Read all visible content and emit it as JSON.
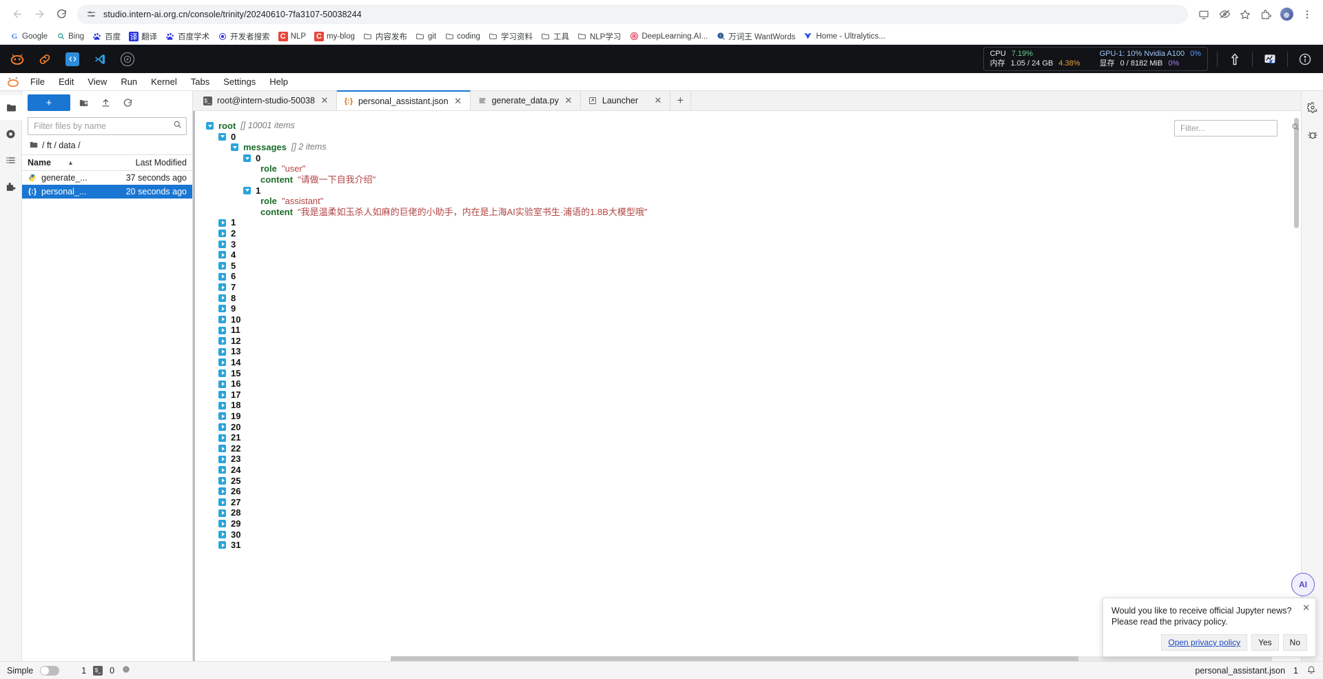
{
  "browser": {
    "nav": {
      "back": "←",
      "forward": "→",
      "reload": "⟳"
    },
    "url": "studio.intern-ai.org.cn/console/trinity/20240610-7fa3107-50038244",
    "right_icons": [
      "media-cast-icon",
      "eye-off-icon",
      "bookmark-star-icon",
      "extensions-icon",
      "profile-avatar",
      "chrome-menu-icon"
    ],
    "bookmarks": [
      {
        "label": "Google",
        "icon": "google-icon"
      },
      {
        "label": "Bing",
        "icon": "bing-search-icon"
      },
      {
        "label": "百度",
        "icon": "baidu-icon"
      },
      {
        "label": "翻译",
        "icon": "translate-icon"
      },
      {
        "label": "百度学术",
        "icon": "baidu-icon"
      },
      {
        "label": "开发者搜索",
        "icon": "devsearch-icon"
      },
      {
        "label": "NLP",
        "icon": "c-red-icon"
      },
      {
        "label": "my-blog",
        "icon": "c-red-icon"
      },
      {
        "label": "内容发布",
        "icon": "folder-icon"
      },
      {
        "label": "git",
        "icon": "folder-icon"
      },
      {
        "label": "coding",
        "icon": "folder-icon"
      },
      {
        "label": "学习资料",
        "icon": "folder-icon"
      },
      {
        "label": "工具",
        "icon": "folder-icon"
      },
      {
        "label": "NLP学习",
        "icon": "folder-icon"
      },
      {
        "label": "DeepLearning.AI...",
        "icon": "deeplearning-ai-icon"
      },
      {
        "label": "万词王 WantWords",
        "icon": "wantwords-icon"
      },
      {
        "label": "Home - Ultralytics...",
        "icon": "ultralytics-icon"
      }
    ]
  },
  "jupyter_topbar": {
    "left_icons": [
      "intern-logo-icon",
      "link-icon",
      "jupyter-square-icon",
      "vscode-icon",
      "compass-icon"
    ],
    "resources": {
      "cpu_label": "CPU",
      "cpu_value": "7.19%",
      "gpu_label": "GPU-1: 10% Nvidia A100",
      "gpu_value": "0%",
      "mem_label": "内存",
      "mem_value": "1.05 / 24 GB",
      "mem_pct": "4.38%",
      "vram_label": "显存",
      "vram_value": "0 / 8182 MiB",
      "vram_pct": "0%"
    },
    "right_icons": [
      "upload-arrow-icon",
      "monitor-chart-icon",
      "info-circle-icon"
    ]
  },
  "menubar": {
    "items": [
      "File",
      "Edit",
      "View",
      "Run",
      "Kernel",
      "Tabs",
      "Settings",
      "Help"
    ]
  },
  "rail": {
    "left_icons": [
      "folder-browser-icon",
      "running-terminals-icon",
      "table-of-contents-icon",
      "extension-manager-icon"
    ],
    "right_icons": [
      "property-inspector-icon",
      "debugger-icon"
    ]
  },
  "filebrowser": {
    "new_label": "+",
    "toolbar_icons": [
      "new-folder-icon",
      "upload-icon",
      "refresh-icon"
    ],
    "filter_placeholder": "Filter files by name",
    "filter_value": "",
    "breadcrumb": "/ ft / data /",
    "columns": {
      "name": "Name",
      "modified": "Last Modified"
    },
    "sort_indicator": "▲",
    "files": [
      {
        "name": "generate_...",
        "modified": "37 seconds ago",
        "icon": "python-file-icon",
        "selected": false
      },
      {
        "name": "personal_...",
        "modified": "20 seconds ago",
        "icon": "json-file-icon",
        "selected": true
      }
    ]
  },
  "tabs": [
    {
      "label": "root@intern-studio-50038",
      "icon": "terminal-icon",
      "active": false
    },
    {
      "label": "personal_assistant.json",
      "icon": "json-file-icon",
      "active": true
    },
    {
      "label": "generate_data.py",
      "icon": "python-file-icon",
      "active": false
    },
    {
      "label": "Launcher",
      "icon": "launcher-icon",
      "active": false
    }
  ],
  "json_viewer": {
    "filter_placeholder": "Filter...",
    "filter_value": "",
    "root": {
      "key": "root",
      "meta": "[]  10001 items"
    },
    "expanded": {
      "index": "0",
      "messages_key": "messages",
      "messages_meta": "[]  2 items",
      "msg0_index": "0",
      "msg0_role_key": "role",
      "msg0_role_val": "\"user\"",
      "msg0_content_key": "content",
      "msg0_content_val": "\"请做一下自我介绍\"",
      "msg1_index": "1",
      "msg1_role_key": "role",
      "msg1_role_val": "\"assistant\"",
      "msg1_content_key": "content",
      "msg1_content_val": "\"我是温柔如玉杀人如麻的巨佬的小助手，内在是上海AI实验室书生·浦语的1.8B大模型哦\""
    },
    "collapsed_indices": [
      "1",
      "2",
      "3",
      "4",
      "5",
      "6",
      "7",
      "8",
      "9",
      "10",
      "11",
      "12",
      "13",
      "14",
      "15",
      "16",
      "17",
      "18",
      "19",
      "20",
      "21",
      "22",
      "23",
      "24",
      "25",
      "26",
      "27",
      "28",
      "29",
      "30",
      "31"
    ]
  },
  "ai_fab": {
    "label": "AI"
  },
  "toast": {
    "line1": "Would you like to receive official Jupyter news?",
    "line2": "Please read the privacy policy.",
    "link": "Open privacy policy",
    "yes": "Yes",
    "no": "No",
    "close": "✕"
  },
  "statusbar": {
    "simple_label": "Simple",
    "toggle_state": "off",
    "terminals_count": "1",
    "kernels_count": "0",
    "kernel_icon": "terminal-icon",
    "memory_icon": "cpu-chip-icon",
    "filename": "personal_assistant.json",
    "notification_count": "1",
    "bell_icon": "bell-icon"
  }
}
